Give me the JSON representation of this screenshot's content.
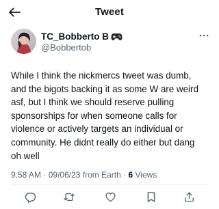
{
  "header": {
    "title": "Tweet",
    "back_icon": "arrow-left-icon"
  },
  "author": {
    "display_name": "TC_Bobberto B",
    "badge_icon": "game-controller-icon",
    "handle": "@Bobbertob",
    "more_icon": "more-horizontal-icon"
  },
  "tweet": {
    "text": "While I think the nickmercs tweet was dumb,\nand the bigots backing it as some W are weird\nasf, but I think we should reserve pulling\nsponsorships for when someone calls for\nviolence or actively targets an individual or\ncommunity. He didnt really do either but dang\noh well"
  },
  "meta": {
    "time": "9:58 AM",
    "date": "09/06/23",
    "source": "from Earth",
    "views_count": "6",
    "views_label": "Views"
  },
  "actions": [
    {
      "icon": "reply-icon"
    },
    {
      "icon": "retweet-icon"
    },
    {
      "icon": "like-icon"
    },
    {
      "icon": "bookmark-icon"
    },
    {
      "icon": "share-icon"
    }
  ],
  "colors": {
    "text": "#0f1419",
    "secondary": "#536471",
    "divider": "#eff3f4"
  }
}
